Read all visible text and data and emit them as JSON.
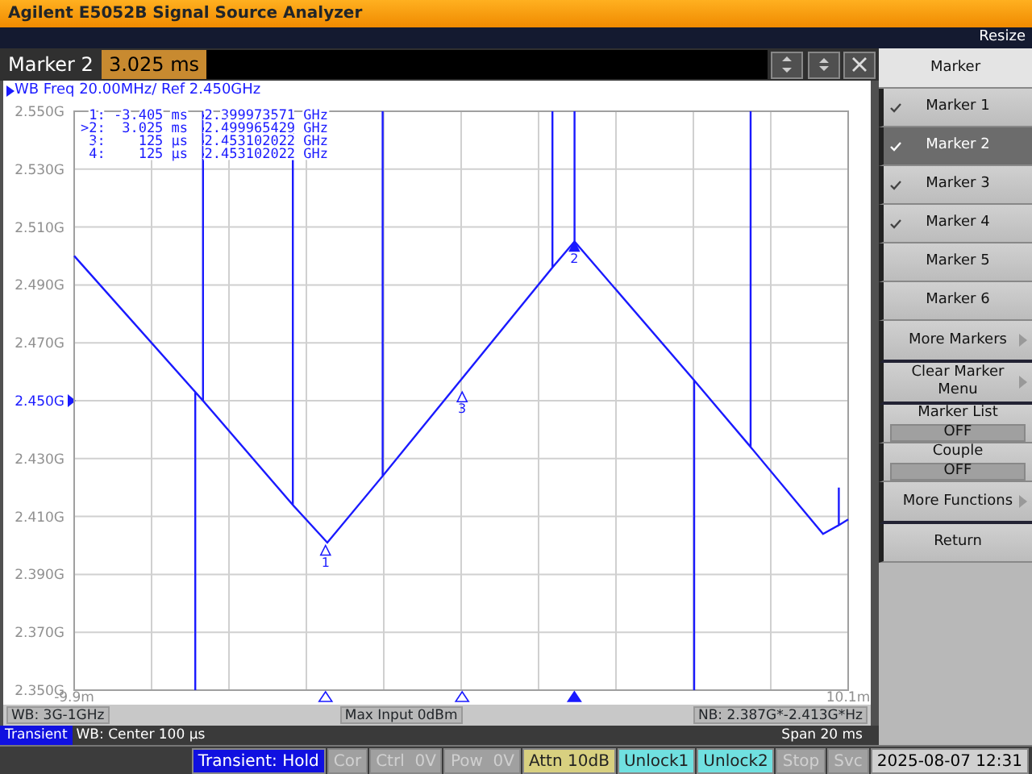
{
  "window": {
    "title": "Agilent E5052B Signal Source Analyzer",
    "resize": "Resize"
  },
  "entry": {
    "label": "Marker 2",
    "value": "3.025 ms"
  },
  "trace_panel": {
    "header": "WB Freq 20.00MHz/ Ref 2.450GHz",
    "marker_table": [
      {
        "label": "1:",
        "time": "-3.405 ms",
        "value": "2.399973571 GHz"
      },
      {
        "label": ">2:",
        "time": "3.025 ms",
        "value": "2.499965429 GHz"
      },
      {
        "label": "3:",
        "time": "125 µs",
        "value": "2.453102022 GHz"
      },
      {
        "label": "4:",
        "time": "125 µs",
        "value": "2.453102022 GHz"
      }
    ],
    "chart_data": {
      "type": "line",
      "xlim": [
        -9.9,
        10.1
      ],
      "ylim": [
        2.35,
        2.55
      ],
      "xticks": [
        {
          "value": -9.9,
          "label": "-9.9m"
        },
        {
          "value": 10.1,
          "label": "10.1m"
        }
      ],
      "yticks": [
        {
          "value": 2.55,
          "label": "2.550G"
        },
        {
          "value": 2.53,
          "label": "2.530G"
        },
        {
          "value": 2.51,
          "label": "2.510G"
        },
        {
          "value": 2.49,
          "label": "2.490G"
        },
        {
          "value": 2.47,
          "label": "2.470G"
        },
        {
          "value": 2.45,
          "label": "2.450G"
        },
        {
          "value": 2.43,
          "label": "2.430G"
        },
        {
          "value": 2.41,
          "label": "2.410G"
        },
        {
          "value": 2.39,
          "label": "2.390G"
        },
        {
          "value": 2.37,
          "label": "2.370G"
        },
        {
          "value": 2.35,
          "label": "2.350G"
        }
      ],
      "grid": true,
      "x": [
        -9.9,
        -6.77,
        -6.77,
        -6.77,
        -6.57,
        -6.57,
        -6.57,
        -4.25,
        -4.25,
        -4.25,
        -3.36,
        -1.93,
        -1.93,
        -1.93,
        2.46,
        2.46,
        2.46,
        3.03,
        3.03,
        3.03,
        6.12,
        6.12,
        6.12,
        7.58,
        7.58,
        7.58,
        9.45,
        9.86,
        9.86,
        9.86,
        10.1
      ],
      "series": [
        {
          "color": "#1a1aff",
          "values": [
            2.5,
            2.453,
            2.35,
            2.453,
            2.45,
            2.55,
            2.45,
            2.414,
            2.55,
            2.414,
            2.401,
            2.424,
            2.55,
            2.424,
            2.496,
            2.55,
            2.496,
            2.505,
            2.55,
            2.505,
            2.457,
            2.35,
            2.457,
            2.434,
            2.55,
            2.434,
            2.404,
            2.407,
            2.42,
            2.407,
            2.409
          ]
        }
      ],
      "annotations": [
        {
          "x": -3.405,
          "y": 2.4,
          "text": "1"
        },
        {
          "x": 3.025,
          "y": 2.505,
          "text": "2"
        },
        {
          "x": 0.125,
          "y": 2.453,
          "text": "3"
        }
      ]
    },
    "reference_marker": true,
    "markers": [
      {
        "selected": false
      },
      {
        "selected": true
      },
      {
        "selected": false
      }
    ]
  },
  "wb_row": [
    "WB: 3G-1GHz",
    "Max Input 0dBm",
    "NB: 2.387G*-2.413G*Hz"
  ],
  "sweep_row": {
    "mode": "Transient",
    "center": "WB: Center 100 µs",
    "span": "Span 20 ms"
  },
  "status_bar": [
    {
      "text": "Transient: Hold",
      "kind": "hold"
    },
    {
      "text": "Cor",
      "kind": "off"
    },
    {
      "text": "Ctrl  0V",
      "kind": "off"
    },
    {
      "text": "Pow  0V",
      "kind": "off"
    },
    {
      "text": "Attn 10dB",
      "kind": "attn"
    },
    {
      "text": "Unlock1",
      "kind": "unlock"
    },
    {
      "text": "Unlock2",
      "kind": "unlock"
    },
    {
      "text": "Stop",
      "kind": "off"
    },
    {
      "text": "Svc",
      "kind": "off"
    },
    {
      "text": "2025-08-07 12:31",
      "kind": "clock"
    }
  ],
  "softkeys": [
    {
      "label": "Marker",
      "kind": "header"
    },
    {
      "label": "Marker 1",
      "kind": "check",
      "checked": true,
      "selected": false
    },
    {
      "label": "Marker 2",
      "kind": "check",
      "checked": true,
      "selected": true
    },
    {
      "label": "Marker 3",
      "kind": "check",
      "checked": true,
      "selected": false
    },
    {
      "label": "Marker 4",
      "kind": "check",
      "checked": true,
      "selected": false
    },
    {
      "label": "Marker 5",
      "kind": "check",
      "checked": false,
      "selected": false
    },
    {
      "label": "Marker 6",
      "kind": "check",
      "checked": false,
      "selected": false
    },
    {
      "label": "More Markers",
      "kind": "menu"
    },
    {
      "label": "Clear Marker Menu",
      "kind": "menu"
    },
    {
      "label": "Marker List",
      "kind": "toggle",
      "value": "OFF"
    },
    {
      "label": "Couple",
      "kind": "toggle",
      "value": "OFF"
    },
    {
      "label": "More Functions",
      "kind": "menu"
    },
    {
      "label": "Return",
      "kind": "plain"
    }
  ]
}
